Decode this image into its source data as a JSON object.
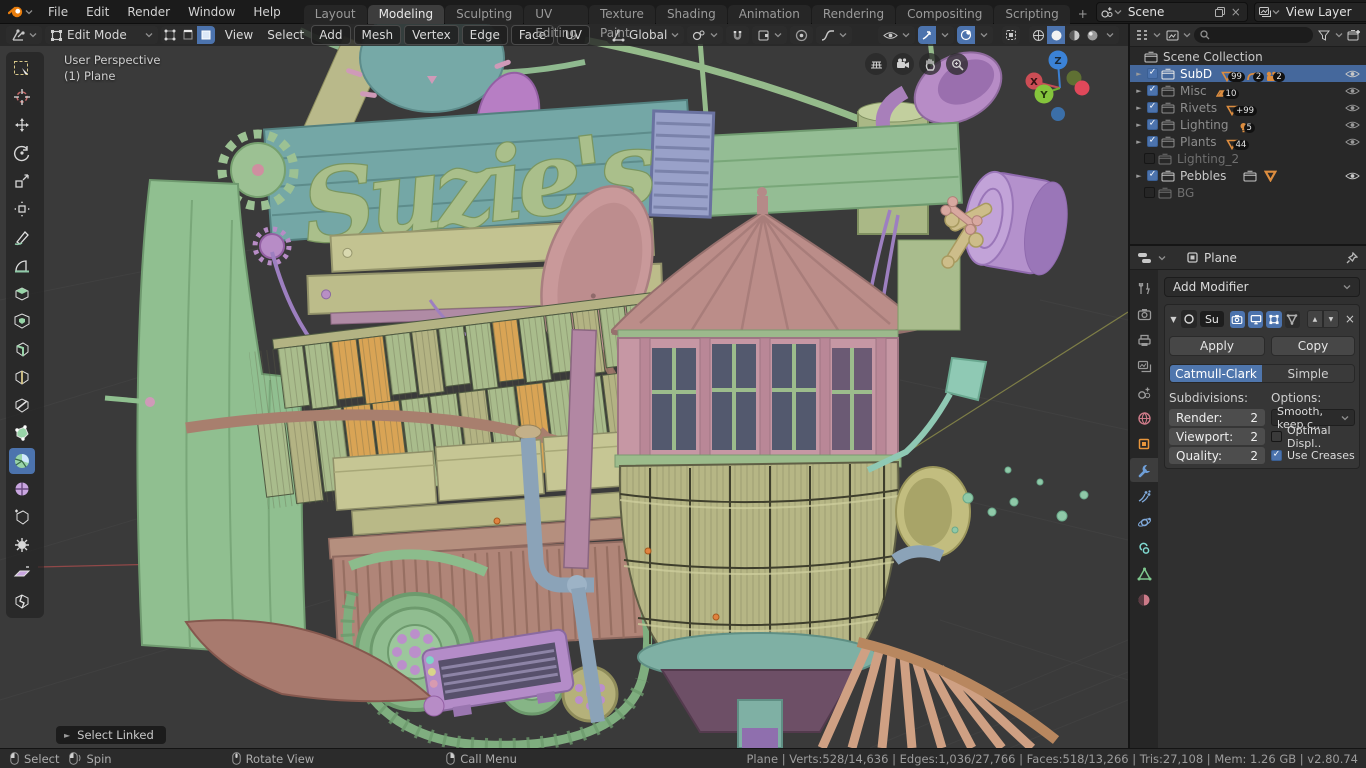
{
  "icons": {
    "checkmark": "✓",
    "close": "×",
    "expand": "▼",
    "collapse": "►",
    "up": "▲",
    "down": "▼",
    "plus": "+"
  },
  "topbar": {
    "menus": [
      "File",
      "Edit",
      "Render",
      "Window",
      "Help"
    ],
    "tabs": [
      {
        "label": "Layout"
      },
      {
        "label": "Modeling"
      },
      {
        "label": "Sculpting"
      },
      {
        "label": "UV Editing"
      },
      {
        "label": "Texture Paint"
      },
      {
        "label": "Shading"
      },
      {
        "label": "Animation"
      },
      {
        "label": "Rendering"
      },
      {
        "label": "Compositing"
      },
      {
        "label": "Scripting"
      },
      {
        "label": "+"
      }
    ],
    "active_tab": "Modeling",
    "scene_label": "Scene",
    "view_layer_label": "View Layer"
  },
  "vp_header": {
    "mode": "Edit Mode",
    "menus": [
      "View",
      "Select",
      "Add",
      "Mesh"
    ],
    "mesh_menus": [
      "Vertex",
      "Edge",
      "Face",
      "UV"
    ],
    "orientation": "Global"
  },
  "viewport": {
    "persp_label": "User Perspective",
    "object_label": "(1) Plane",
    "operator_label": "Select Linked",
    "sign_text": "Suzie's",
    "gizmo": {
      "x": "X",
      "y": "Y",
      "z": "Z"
    }
  },
  "toolbar_tools": [
    "select-box",
    "cursor",
    "move",
    "rotate",
    "scale",
    "transform",
    "annotate",
    "measure",
    "extrude-region",
    "inset-faces",
    "bevel",
    "loop-cut",
    "knife",
    "poly-build",
    "spin",
    "smooth",
    "edge-slide",
    "shrink-fatten",
    "shear",
    "rip-region"
  ],
  "outliner": {
    "root": "Scene Collection",
    "rows": [
      {
        "label": "SubD",
        "badge1": "99",
        "badge2": "2",
        "badge3": "2"
      },
      {
        "label": "Misc",
        "badge1": "10"
      },
      {
        "label": "Rivets",
        "badge1": "+99"
      },
      {
        "label": "Lighting",
        "badge1": "5"
      },
      {
        "label": "Plants",
        "badge1": "44"
      },
      {
        "label": "Lighting_2"
      },
      {
        "label": "Pebbles"
      },
      {
        "label": "BG"
      }
    ]
  },
  "properties": {
    "breadcrumb": "Plane",
    "add_modifier": "Add Modifier",
    "modifier": {
      "name": "Su",
      "apply": "Apply",
      "copy": "Copy",
      "algo_active": "Catmull-Clark",
      "algo_other": "Simple",
      "subdivisions_label": "Subdivisions:",
      "options_label": "Options:",
      "render_label": "Render:",
      "render_value": "2",
      "viewport_label": "Viewport:",
      "viewport_value": "2",
      "quality_label": "Quality:",
      "quality_value": "2",
      "uv_smooth": "Smooth, keep c..",
      "optimal_display": "Optimal Displ..",
      "use_creases": "Use Creases"
    }
  },
  "statusbar": {
    "hint_select": "Select",
    "hint_spin": "Spin",
    "hint_rotate": "Rotate View",
    "hint_call_menu": "Call Menu",
    "stats": "Plane | Verts:528/14,636 | Edges:1,036/27,766 | Faces:518/13,266 | Tris:27,108 | Mem: 1.26 GB | v2.80.74"
  }
}
